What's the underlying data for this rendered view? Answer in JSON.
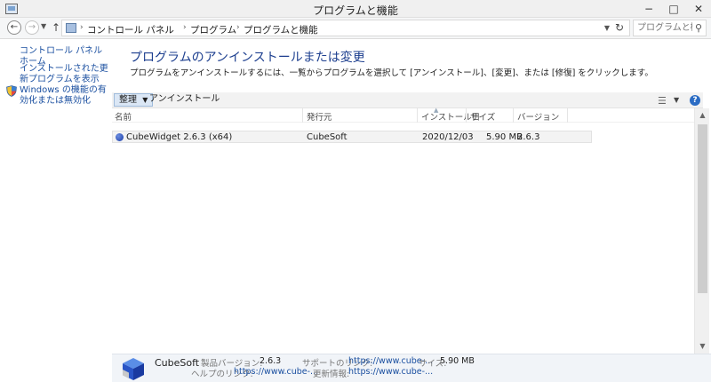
{
  "window": {
    "title": "プログラムと機能",
    "controls": {
      "minimize": "−",
      "maximize": "□",
      "close": "✕"
    }
  },
  "address_bar": {
    "breadcrumbs": [
      "コントロール パネル",
      "プログラム",
      "プログラムと機能"
    ],
    "search_placeholder": "プログラムと機能の検索"
  },
  "left_pane": {
    "home": "コントロール パネル ホーム",
    "installed_updates": "インストールされた更新プログラムを表示",
    "windows_features": "Windows の機能の有効化または無効化"
  },
  "main": {
    "heading": "プログラムのアンインストールまたは変更",
    "subtext": "プログラムをアンインストールするには、一覧からプログラムを選択して [アンインストール]、[変更]、または [修復] をクリックします。"
  },
  "toolbar": {
    "organize": "整理",
    "uninstall": "アンインストール",
    "help": "?"
  },
  "columns": {
    "name": "名前",
    "publisher": "発行元",
    "installed_on": "インストール日",
    "size": "サイズ",
    "version": "バージョン"
  },
  "programs": [
    {
      "name": "CubeWidget 2.6.3 (x64)",
      "publisher": "CubeSoft",
      "installed_on": "2020/12/03",
      "size": "5.90 MB",
      "version": "2.6.3"
    }
  ],
  "details": {
    "publisher": "CubeSoft",
    "product_version_label": "製品バージョン:",
    "product_version": "2.6.3",
    "support_link_label": "サポートのリンク:",
    "support_link": "https://www.cube-...",
    "size_label": "サイズ:",
    "size": "5.90 MB",
    "help_link_label": "ヘルプのリンク:",
    "help_link": "https://www.cube-...",
    "update_info_label": "更新情報:",
    "update_info": "https://www.cube-..."
  },
  "colors": {
    "link": "#1a4fa0",
    "heading": "#1d3f8f",
    "accent": "#2b6cc4"
  }
}
